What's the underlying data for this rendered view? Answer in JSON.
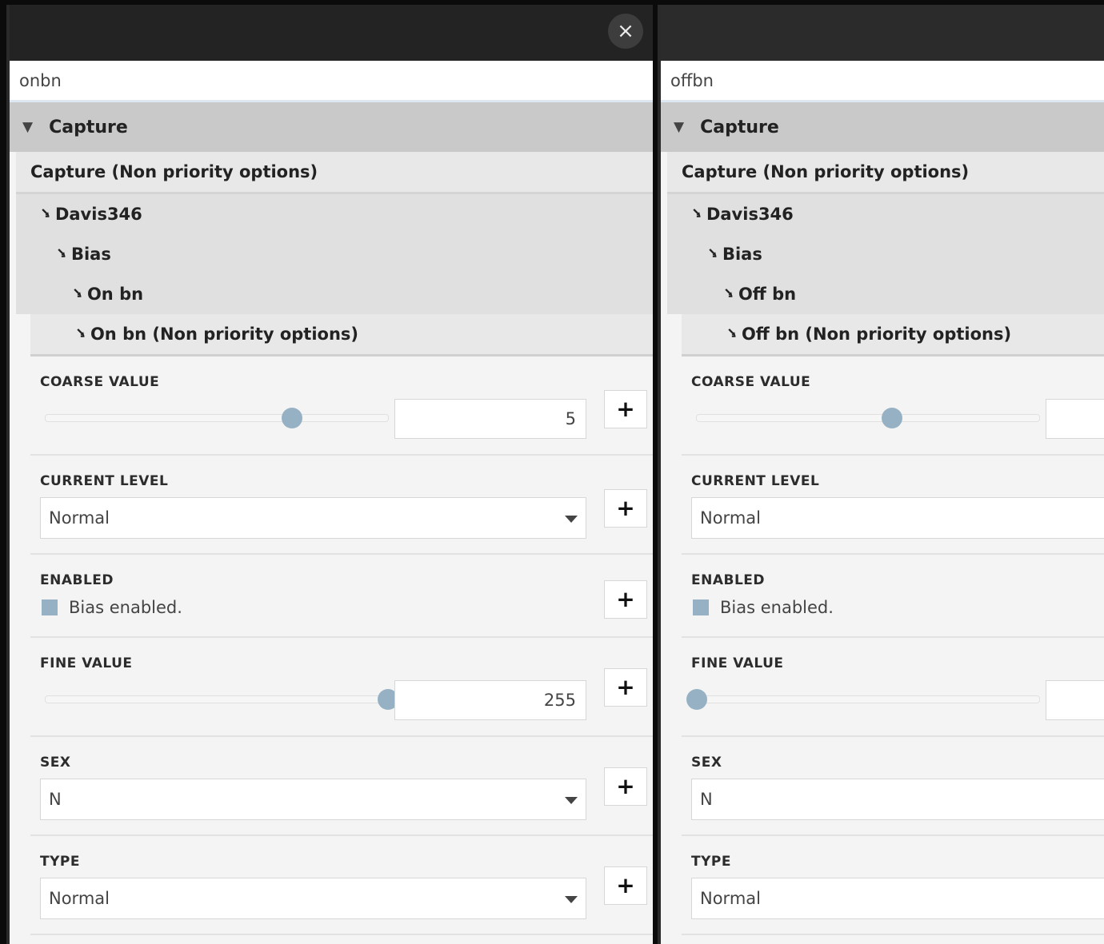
{
  "close_label": "×",
  "panels": [
    {
      "name": "onbn",
      "section": "Capture",
      "subsection": "Capture (Non priority options)",
      "tree": [
        "Davis346",
        "Bias",
        "On bn"
      ],
      "options_title": "On bn (Non priority options)",
      "coarse_label": "COARSE VALUE",
      "coarse_value": "5",
      "coarse_fraction": 0.72,
      "current_label": "CURRENT LEVEL",
      "current_value": "Normal",
      "enabled_label": "ENABLED",
      "enabled_text": "Bias enabled.",
      "fine_label": "FINE VALUE",
      "fine_value": "255",
      "fine_fraction": 1.0,
      "sex_label": "SEX",
      "sex_value": "N",
      "type_label": "TYPE",
      "type_value": "Normal",
      "plus": "+"
    },
    {
      "name": "offbn",
      "section": "Capture",
      "subsection": "Capture (Non priority options)",
      "tree": [
        "Davis346",
        "Bias",
        "Off bn"
      ],
      "options_title": "Off bn (Non priority options)",
      "coarse_label": "COARSE VALUE",
      "coarse_fraction": 0.57,
      "current_label": "CURRENT LEVEL",
      "current_value": "Normal",
      "enabled_label": "ENABLED",
      "enabled_text": "Bias enabled.",
      "fine_label": "FINE VALUE",
      "fine_fraction": 0.0,
      "sex_label": "SEX",
      "sex_value": "N",
      "type_label": "TYPE",
      "type_value": "Normal",
      "plus": "+"
    }
  ],
  "icons": {
    "collapse": "triangle-down-icon",
    "expand_arrow": "arrow-down-right-icon",
    "close": "close-icon"
  },
  "colors": {
    "titlebar": "#232323",
    "accent": "#97b1c4",
    "section_header": "#c9c9c9"
  }
}
